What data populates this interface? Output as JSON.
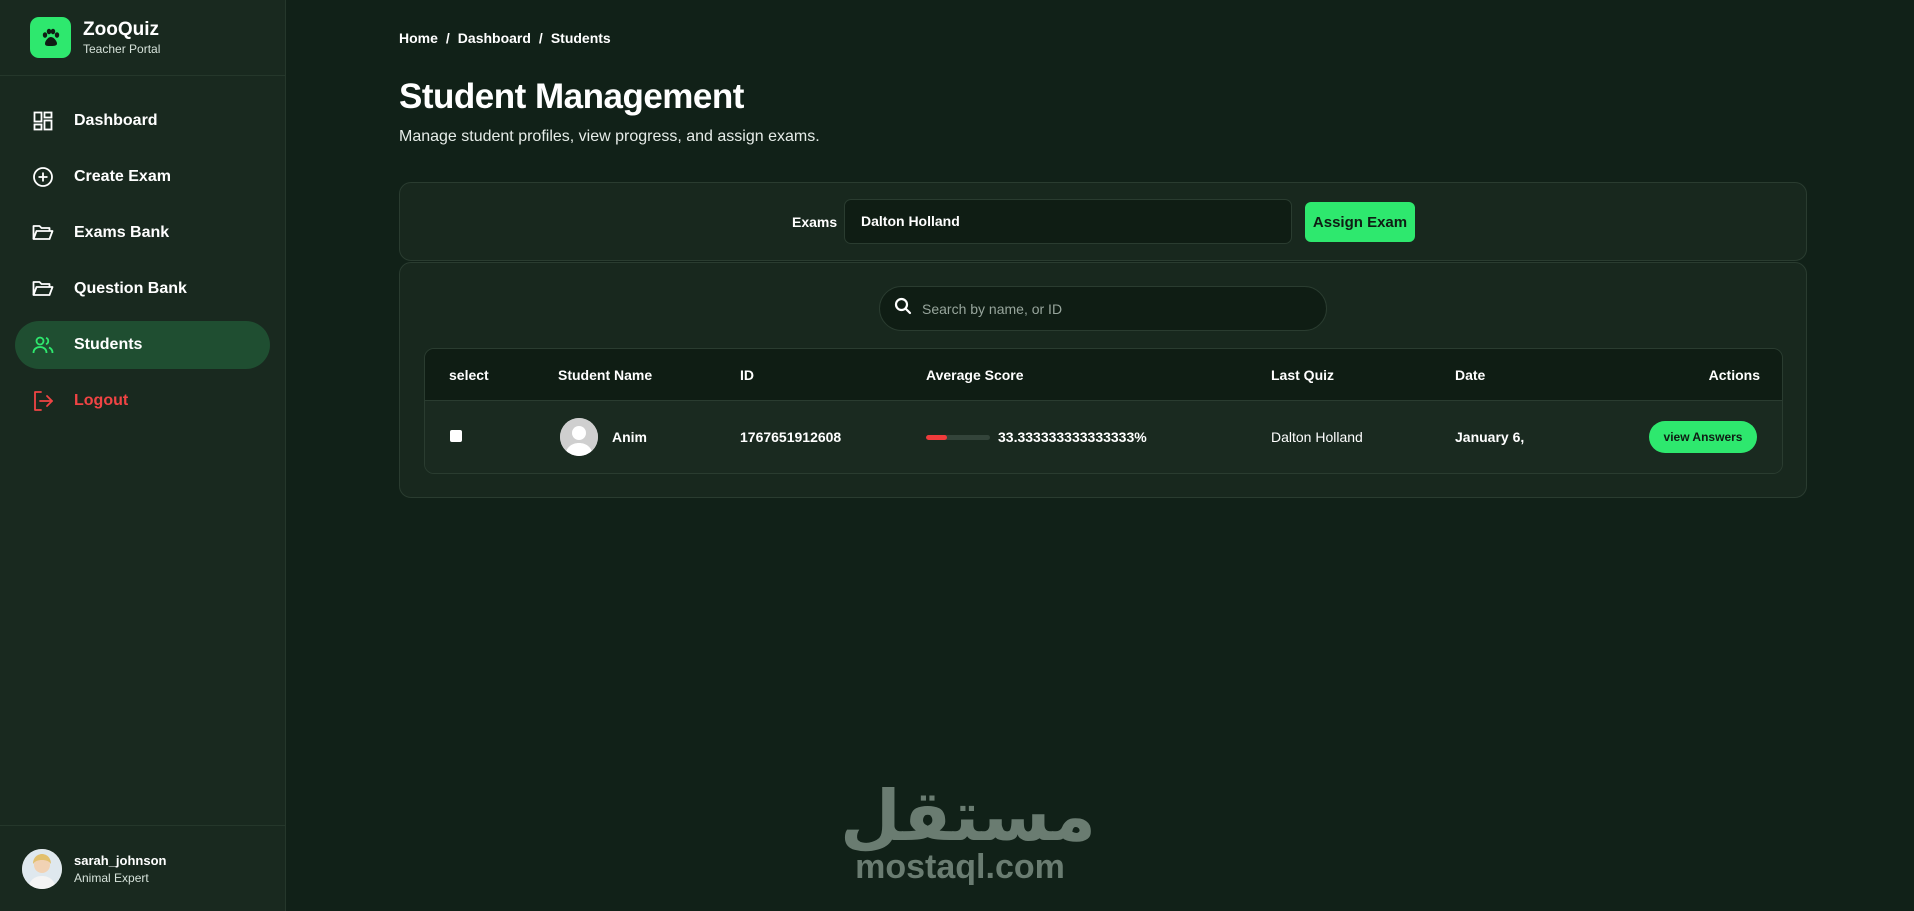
{
  "app": {
    "name": "ZooQuiz",
    "subtitle": "Teacher Portal"
  },
  "sidebar": {
    "items": [
      {
        "label": "Dashboard",
        "icon": "dashboard-icon"
      },
      {
        "label": "Create Exam",
        "icon": "plus-circle-icon"
      },
      {
        "label": "Exams Bank",
        "icon": "folder-open-icon"
      },
      {
        "label": "Question Bank",
        "icon": "folder-open-icon"
      },
      {
        "label": "Students",
        "icon": "users-icon",
        "active": true
      },
      {
        "label": "Logout",
        "icon": "logout-icon"
      }
    ]
  },
  "user": {
    "name": "sarah_johnson",
    "role": "Animal Expert"
  },
  "breadcrumb": [
    "Home",
    "Dashboard",
    "Students"
  ],
  "page": {
    "title": "Student Management",
    "subtitle": "Manage student profiles, view progress, and assign exams."
  },
  "assign": {
    "label": "Exams",
    "selected": "Dalton Holland",
    "button": "Assign Exam"
  },
  "search": {
    "placeholder": "Search by name, or ID"
  },
  "table": {
    "columns": [
      "select",
      "Student Name",
      "ID",
      "Average Score",
      "Last Quiz",
      "Date",
      "Actions"
    ],
    "rows": [
      {
        "name": "Anim",
        "id": "1767651912608",
        "score": "33.333333333333333%",
        "score_fraction": 0.333,
        "last_quiz": "Dalton Holland",
        "date": "January 6,",
        "action": "view Answers"
      }
    ]
  },
  "colors": {
    "accent": "#2ee86e",
    "danger": "#f04444",
    "bg": "#112118"
  },
  "watermark": {
    "arabic": "مستقل",
    "latin": "mostaql.com"
  }
}
